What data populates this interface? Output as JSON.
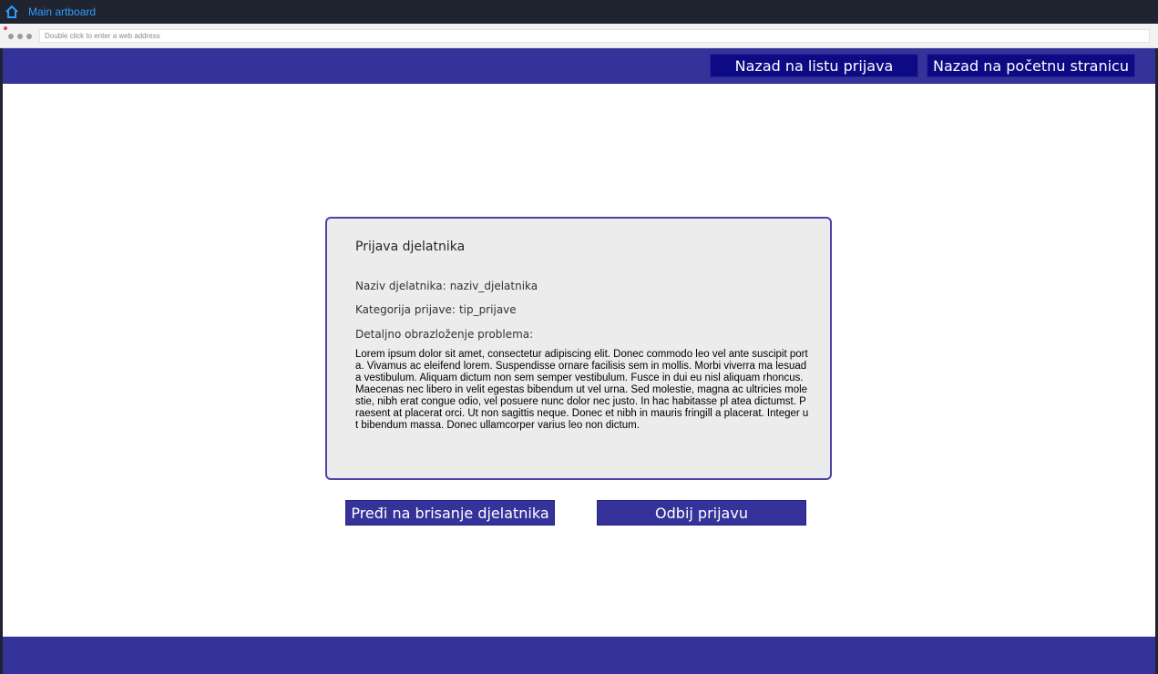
{
  "toolbar": {
    "artboard_label": "Main artboard",
    "home_icon": "home-icon"
  },
  "browser": {
    "address_placeholder": "Double click to enter a web address"
  },
  "colors": {
    "header": "#35329a",
    "nav_button": "#0e0a84",
    "card_border": "#4a43a8",
    "card_bg": "#ececec",
    "topbar": "#1f2430",
    "link": "#2f9bff"
  },
  "header": {
    "back_to_list_label": "Nazad na listu prijava",
    "back_to_home_label": "Nazad na početnu stranicu"
  },
  "report": {
    "title": "Prijava djelatnika",
    "employee_label": "Naziv djelatnika:",
    "employee_value": "naziv_djelatnika",
    "category_label": "Kategorija prijave:",
    "category_value": "tip_prijave",
    "detail_label": "Detaljno obrazloženje problema:",
    "description": "Lorem ipsum dolor sit amet, consectetur adipiscing elit. Donec commodo leo vel ante suscipit porta. Vivamus ac eleifend lorem. Suspendisse ornare facilisis sem in mollis. Morbi viverra ma lesuada vestibulum. Aliquam dictum non sem semper vestibulum. Fusce in dui eu nisl aliquam rhoncus. Maecenas nec libero in velit egestas bibendum ut vel urna. Sed molestie, magna ac ultricies molestie, nibh erat congue odio, vel posuere nunc dolor nec justo. In hac habitasse pl atea dictumst. Praesent at placerat orci. Ut non sagittis neque. Donec et nibh in mauris fringill a placerat. Integer ut bibendum massa. Donec ullamcorper varius leo non dictum."
  },
  "actions": {
    "delete_label": "Pređi na brisanje djelatnika",
    "reject_label": "Odbij prijavu"
  }
}
